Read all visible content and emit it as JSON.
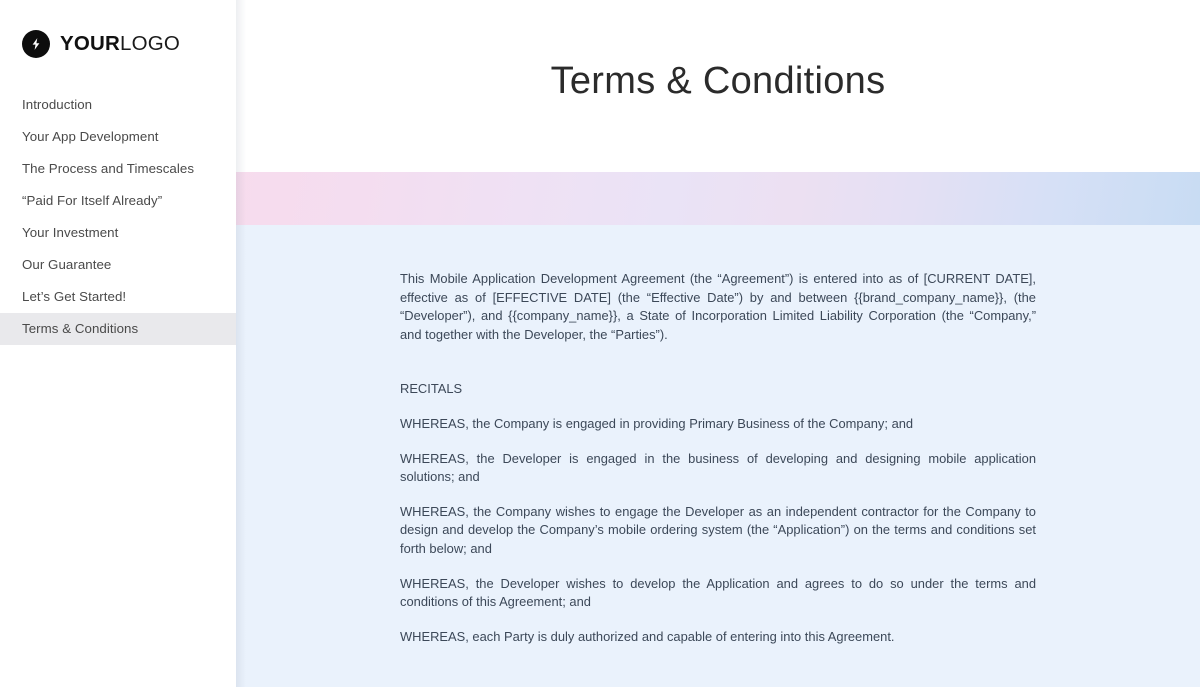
{
  "sidebar": {
    "logo": {
      "icon": "lightning-bolt-icon",
      "text_bold": "YOUR",
      "text_light": "LOGO"
    },
    "items": [
      {
        "label": "Introduction",
        "active": false
      },
      {
        "label": "Your App Development",
        "active": false
      },
      {
        "label": "The Process and Timescales",
        "active": false
      },
      {
        "label": "“Paid For Itself Already”",
        "active": false
      },
      {
        "label": "Your Investment",
        "active": false
      },
      {
        "label": "Our Guarantee",
        "active": false
      },
      {
        "label": "Let’s Get Started!",
        "active": false
      },
      {
        "label": "Terms & Conditions",
        "active": true
      }
    ]
  },
  "document": {
    "title": "Terms & Conditions",
    "paragraphs": [
      "This Mobile Application Development Agreement (the “Agreement”) is entered into as of [CURRENT DATE], effective as of [EFFECTIVE DATE] (the “Effective Date”) by and between {{brand_company_name}}, (the “Developer”), and {{company_name}}, a State of Incorporation Limited Liability Corporation (the “Company,” and together with the Developer, the “Parties”).",
      "RECITALS",
      "WHEREAS, the Company is engaged in providing Primary Business of the Company; and",
      "WHEREAS, the Developer is engaged in the business of developing and designing mobile application solutions; and",
      "WHEREAS, the Company wishes to engage the Developer as an independent contractor for the Company to design and develop the Company’s mobile ordering system (the “Application”) on the terms and conditions set forth below; and",
      "WHEREAS, the Developer wishes to develop the Application and agrees to do so under the terms and conditions of this Agreement; and",
      "WHEREAS, each Party is duly authorized and capable of entering into this Agreement."
    ]
  },
  "colors": {
    "content_background": "#eaf2fc",
    "banner_gradient_start": "#f7dced",
    "banner_gradient_end": "#c8dcf3",
    "sidebar_active_background": "#e9e9ec",
    "body_text": "#3c4858",
    "logo_mark": "#0d0d0d"
  }
}
